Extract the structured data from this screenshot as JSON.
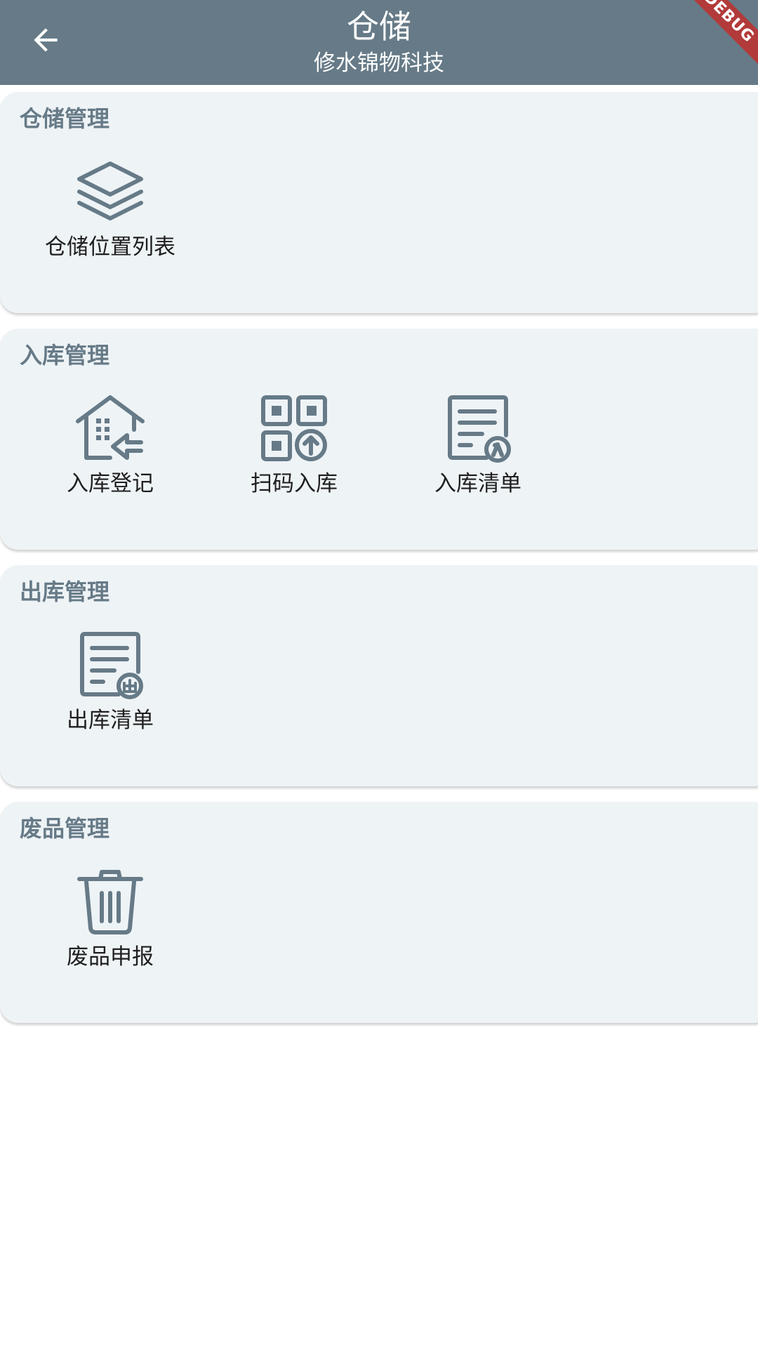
{
  "appbar": {
    "title": "仓储",
    "subtitle": "修水锦物科技",
    "debug_label": "DEBUG"
  },
  "colors": {
    "appbar_bg": "#667a87",
    "card_bg": "#eef3f6",
    "icon": "#667a87",
    "section_title": "#667a87"
  },
  "sections": [
    {
      "title": "仓储管理",
      "items": [
        {
          "label": "仓储位置列表",
          "icon": "layers-icon"
        }
      ]
    },
    {
      "title": "入库管理",
      "items": [
        {
          "label": "入库登记",
          "icon": "warehouse-inbound-icon"
        },
        {
          "label": "扫码入库",
          "icon": "qr-upload-icon"
        },
        {
          "label": "入库清单",
          "icon": "inbound-list-icon"
        }
      ]
    },
    {
      "title": "出库管理",
      "items": [
        {
          "label": "出库清单",
          "icon": "outbound-list-icon"
        }
      ]
    },
    {
      "title": "废品管理",
      "items": [
        {
          "label": "废品申报",
          "icon": "trash-icon"
        }
      ]
    }
  ]
}
